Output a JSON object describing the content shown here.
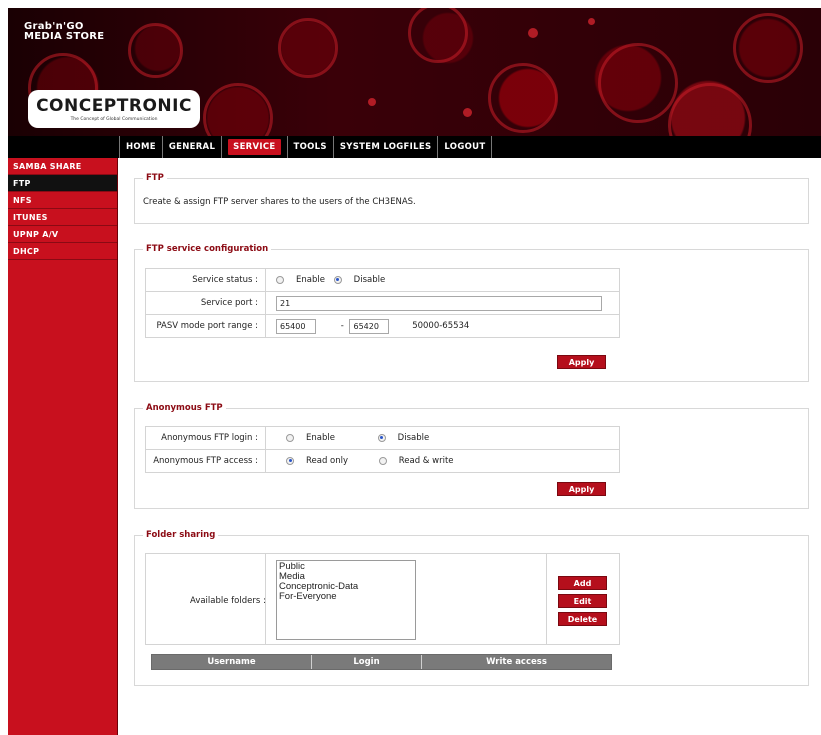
{
  "header": {
    "brand_line1": "Grab'n'GO",
    "brand_line2": "MEDIA STORE",
    "logo": "CONCEPTRONIC",
    "logo_tagline": "The Concept of Global Communication"
  },
  "nav": {
    "items": [
      {
        "label": "HOME"
      },
      {
        "label": "GENERAL"
      },
      {
        "label": "SERVICE",
        "active": true
      },
      {
        "label": "TOOLS"
      },
      {
        "label": "SYSTEM LOGFILES"
      },
      {
        "label": "LOGOUT"
      }
    ]
  },
  "sidebar": {
    "items": [
      {
        "label": "SAMBA SHARE"
      },
      {
        "label": "FTP",
        "active": true
      },
      {
        "label": "NFS"
      },
      {
        "label": "ITUNES"
      },
      {
        "label": "UPNP A/V"
      },
      {
        "label": "DHCP"
      }
    ]
  },
  "ftp_intro": {
    "title": "FTP",
    "description": "Create & assign FTP server shares to the users of the CH3ENAS."
  },
  "ftp_config": {
    "title": "FTP service configuration",
    "status_label": "Service status :",
    "enable_label": "Enable",
    "disable_label": "Disable",
    "status_selected": "Disable",
    "port_label": "Service port :",
    "port_value": "21",
    "pasv_label": "PASV mode port range :",
    "pasv_from": "65400",
    "pasv_dash": "-",
    "pasv_to": "65420",
    "pasv_hint": "50000-65534",
    "apply_label": "Apply"
  },
  "anonymous": {
    "title": "Anonymous FTP",
    "login_label": "Anonymous FTP login :",
    "login_enable": "Enable",
    "login_disable": "Disable",
    "login_selected": "Disable",
    "access_label": "Anonymous FTP access :",
    "access_readonly": "Read only",
    "access_readwrite": "Read & write",
    "access_selected": "Read only",
    "apply_label": "Apply"
  },
  "sharing": {
    "title": "Folder sharing",
    "available_label": "Available folders :",
    "folders": [
      "Public",
      "Media",
      "Conceptronic-Data",
      "For-Everyone"
    ],
    "add_label": "Add",
    "edit_label": "Edit",
    "delete_label": "Delete",
    "columns": [
      "Username",
      "Login",
      "Write access"
    ]
  }
}
